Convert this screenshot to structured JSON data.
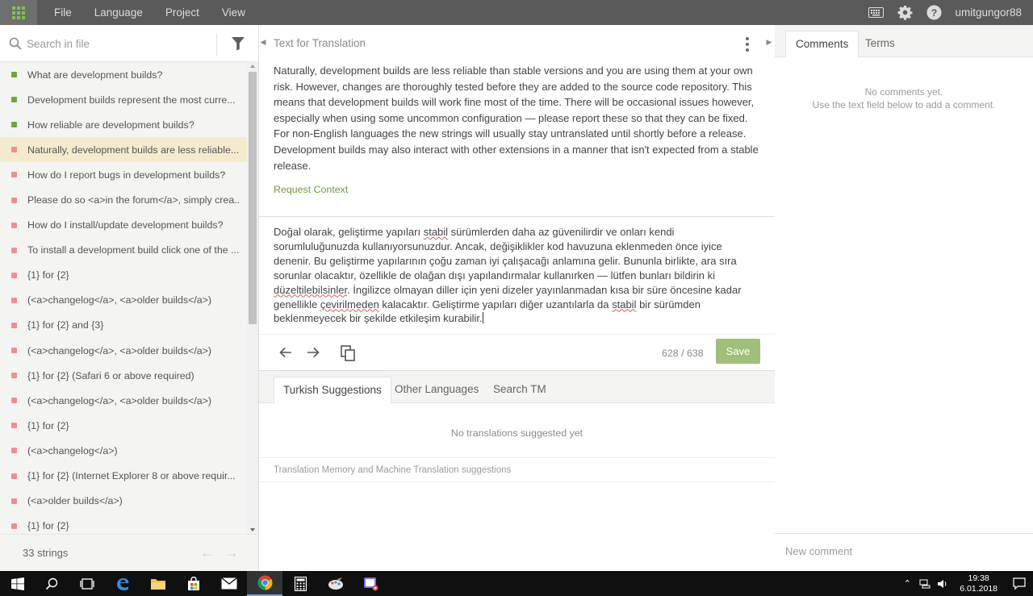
{
  "app": {
    "menu": [
      "File",
      "Language",
      "Project",
      "View"
    ],
    "username": "umitgungor88",
    "accent_green": "#7ec24e"
  },
  "left_panel": {
    "search_placeholder": "Search in file",
    "strings": [
      {
        "text": "What are development builds?",
        "status": "translated"
      },
      {
        "text": "Development builds represent the most curre...",
        "status": "translated"
      },
      {
        "text": "How reliable are development builds?",
        "status": "translated"
      },
      {
        "text": "Naturally, development builds are less reliable...",
        "status": "untranslated",
        "active": true
      },
      {
        "text": "How do I report bugs in development builds?",
        "status": "untranslated"
      },
      {
        "text": "Please do so <a>in the forum</a>, simply crea...",
        "status": "untranslated"
      },
      {
        "text": "How do I install/update development builds?",
        "status": "untranslated"
      },
      {
        "text": "To install a development build click one of the ...",
        "status": "untranslated"
      },
      {
        "text": "{1} for {2}",
        "status": "untranslated"
      },
      {
        "text": "(<a>changelog</a>, <a>older builds</a>)",
        "status": "untranslated"
      },
      {
        "text": "{1} for {2} and {3}",
        "status": "untranslated"
      },
      {
        "text": "(<a>changelog</a>, <a>older builds</a>)",
        "status": "untranslated"
      },
      {
        "text": "{1} for {2} (Safari 6 or above required)",
        "status": "untranslated"
      },
      {
        "text": "(<a>changelog</a>, <a>older builds</a>)",
        "status": "untranslated"
      },
      {
        "text": "{1} for {2}",
        "status": "untranslated"
      },
      {
        "text": "(<a>changelog</a>)",
        "status": "untranslated"
      },
      {
        "text": "{1} for {2} (Internet Explorer 8 or above requir...",
        "status": "untranslated"
      },
      {
        "text": "(<a>older builds</a>)",
        "status": "untranslated"
      },
      {
        "text": "{1} for {2}",
        "status": "untranslated"
      }
    ],
    "count_label": "33 strings"
  },
  "center_panel": {
    "header": "Text for Translation",
    "source_text": "Naturally, development builds are less reliable than stable versions and you are using them at your own risk. However, changes are thoroughly tested before they are added to the source code repository. This means that development builds will work fine most of the time. There will be occasional issues however, especially when using some uncommon configuration — please report these so that they can be fixed. For non-English languages the new strings will usually stay untranslated until shortly before a release. Development builds may also interact with other extensions in a manner that isn't expected from a stable release.",
    "request_context": "Request Context",
    "translation_segments": [
      {
        "t": "Doğal olarak, geliştirme yapıları "
      },
      {
        "t": "stabil",
        "spell": true
      },
      {
        "t": " sürümlerden daha az güvenilirdir ve onları kendi sorumluluğunuzda kullanıyorsunuzdur. Ancak, değişiklikler kod havuzuna eklenmeden önce iyice denenir. Bu geliştirme yapılarının çoğu zaman iyi çalışacağı anlamına gelir. Bununla birlikte, ara sıra sorunlar olacaktır, özellikle de olağan dışı yapılandırmalar kullanırken — lütfen bunları bildirin ki "
      },
      {
        "t": "düzeltilebilsinler",
        "spell": true
      },
      {
        "t": ". İngilizce olmayan diller için yeni dizeler yayınlanmadan kısa bir süre öncesine kadar genellikle "
      },
      {
        "t": "çevirilmeden",
        "spell": true
      },
      {
        "t": " kalacaktır. Geliştirme yapıları diğer uzantılarla da "
      },
      {
        "t": "stabil",
        "spell": true
      },
      {
        "t": " bir sürümden beklenmeyecek bir şekilde etkileşim kurabilir."
      }
    ],
    "char_count": "628 / 638",
    "save_label": "Save",
    "save_color": "#9fbf7a",
    "suggestion_tabs": [
      "Turkish Suggestions",
      "Other Languages",
      "Search TM"
    ],
    "no_suggestions": "No translations suggested yet",
    "tm_note": "Translation Memory and Machine Translation suggestions"
  },
  "right_panel": {
    "tabs": [
      "Comments",
      "Terms"
    ],
    "no_comments_line1": "No comments yet.",
    "no_comments_line2": "Use the text field below to add a comment.",
    "new_comment_placeholder": "New comment"
  },
  "taskbar": {
    "time": "19:38",
    "date": "6.01.2018"
  }
}
